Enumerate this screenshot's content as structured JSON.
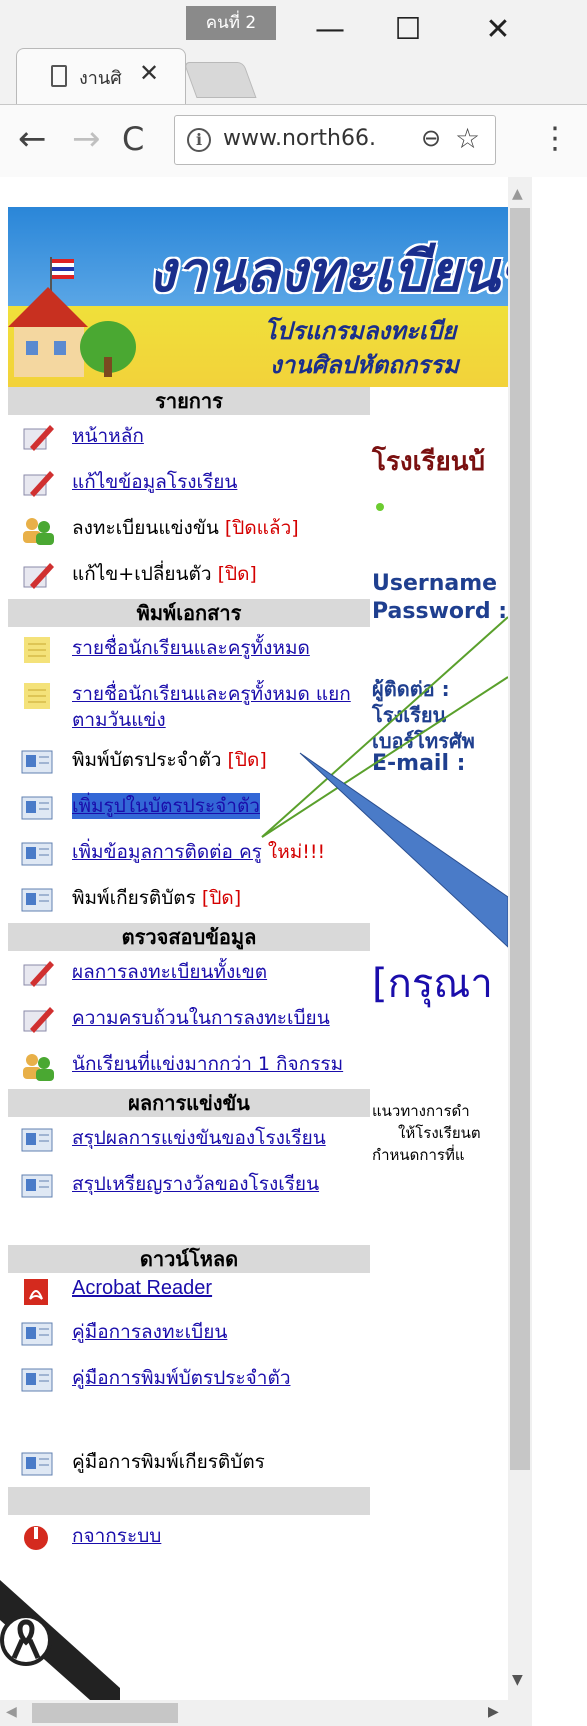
{
  "browser": {
    "profile_label": "คนที่ 2",
    "minimize": "—",
    "maximize": "☐",
    "close": "✕",
    "tab_title": "งานศิ",
    "tab_close": "✕",
    "nav_back": "←",
    "nav_forward": "→",
    "nav_reload": "C",
    "info": "i",
    "url": "www.north66.",
    "zoom": "⊖",
    "star": "☆",
    "menu": "⋮"
  },
  "banner": {
    "title": "งานลงทะเบียนข",
    "subtitle1": "โปรแกรมลงทะเบีย",
    "subtitle2": "งานศิลปหัตถกรรม"
  },
  "menu": {
    "sections": [
      {
        "header": "รายการ",
        "items": [
          {
            "label": "หน้าหลัก",
            "link": true,
            "icon": "pencil-icon"
          },
          {
            "label": "แก้ไขข้อมูลโรงเรียน",
            "link": true,
            "icon": "pencil-icon"
          },
          {
            "label": "ลงทะเบียนแข่งขัน",
            "tag": "[ปิดแล้ว]",
            "link": false,
            "icon": "users-icon"
          },
          {
            "label": "แก้ไข+เปลี่ยนตัว",
            "tag": "[ปิด]",
            "link": false,
            "icon": "pencil-icon"
          }
        ]
      },
      {
        "header": "พิมพ์เอกสาร",
        "items": [
          {
            "label": "รายชื่อนักเรียนและครูทั้งหมด",
            "link": true,
            "icon": "note-icon"
          },
          {
            "label": "รายชื่อนักเรียนและครูทั้งหมด แยกตามวันแข่ง",
            "link": true,
            "icon": "note-icon"
          },
          {
            "label": "พิมพ์บัตรประจำตัว",
            "tag": "[ปิด]",
            "link": false,
            "icon": "card-icon"
          },
          {
            "label": "เพิ่มรูปในบัตรประจำตัว",
            "link": true,
            "icon": "card-icon"
          },
          {
            "label": "เพิ่มข้อมูลการติดต่อ ครู",
            "tag": "ใหม่!!!",
            "link": true,
            "icon": "card-icon"
          },
          {
            "label": "พิมพ์เกียรติบัตร",
            "tag": "[ปิด]",
            "link": false,
            "icon": "card-icon"
          }
        ]
      },
      {
        "header": "ตรวจสอบข้อมูล",
        "items": [
          {
            "label": "ผลการลงทะเบียนทั้งเขต",
            "link": true,
            "icon": "pencil-icon"
          },
          {
            "label": "ความครบถ้วนในการลงทะเบียน",
            "link": true,
            "icon": "pencil-icon"
          },
          {
            "label": "นักเรียนที่แข่งมากกว่า 1 กิจกรรม",
            "link": true,
            "icon": "users-icon"
          }
        ]
      },
      {
        "header": "ผลการแข่งขัน",
        "items": [
          {
            "label": "สรุปผลการแข่งขันของโรงเรียน",
            "link": true,
            "icon": "card-icon"
          },
          {
            "label": "สรุปเหรียญรางวัลของโรงเรียน",
            "link": true,
            "icon": "card-icon"
          }
        ]
      },
      {
        "header": "ดาวน์โหลด",
        "items": [
          {
            "label": "Acrobat Reader",
            "link": true,
            "icon": "pdf-icon"
          },
          {
            "label": "คู่มือการลงทะเบียน",
            "link": true,
            "icon": "card-icon"
          },
          {
            "label": "คู่มือการพิมพ์บัตรประจำตัว",
            "link": true,
            "icon": "card-icon"
          },
          {
            "label": "คู่มือการพิมพ์เกียรติบัตร",
            "link": false,
            "icon": "card-icon"
          }
        ]
      },
      {
        "header": "",
        "items": [
          {
            "label": "กจากระบบ",
            "link": true,
            "icon": "logout-icon"
          }
        ]
      }
    ]
  },
  "right": {
    "school": "โรงเรียนบ้",
    "username": "Username",
    "password": "Password :",
    "contact1": "ผู้ติดต่อ :",
    "contact2": "โรงเรียน",
    "contact3": "เบอร์โทรศัพ",
    "email": "E-mail :",
    "please": "[กรุณา",
    "note1": "แนวทางการดำ",
    "note2": "ให้โรงเรียนต",
    "note3": "กำหนดการที่แ"
  },
  "colors": {
    "link": "#1a0dab",
    "tag_red": "#d40000",
    "header_bg": "#d9d9d9",
    "selected_bg": "#3367d6",
    "callout_blue": "#4a7bc8",
    "callout_green": "#5aa02c"
  }
}
